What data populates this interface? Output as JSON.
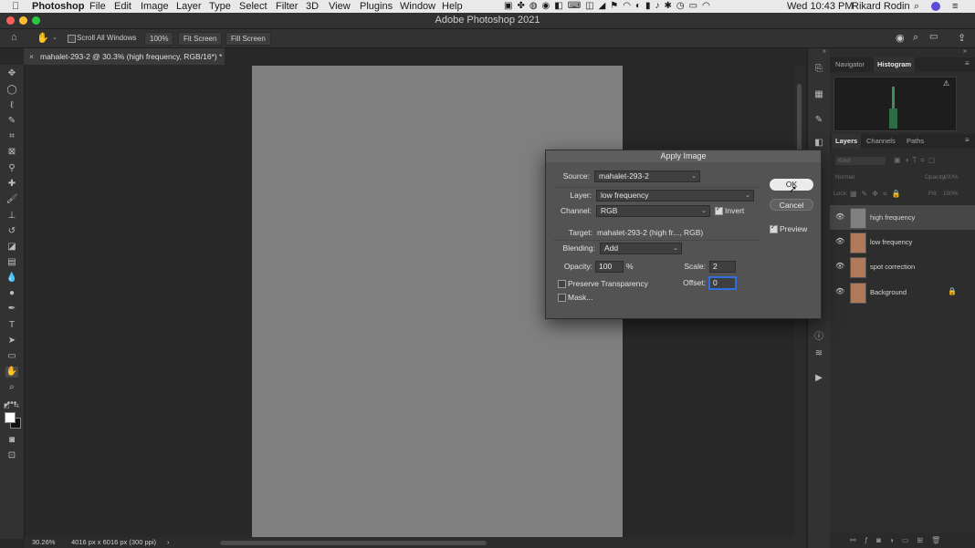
{
  "menubar": {
    "apple_icon": "apple-icon",
    "app": "Photoshop",
    "items": [
      "File",
      "Edit",
      "Image",
      "Layer",
      "Type",
      "Select",
      "Filter",
      "3D",
      "View",
      "Plugins",
      "Window",
      "Help"
    ],
    "clock": "Wed 10:43 PM",
    "user": "Rikard Rodin"
  },
  "window": {
    "title": "Adobe Photoshop 2021"
  },
  "options": {
    "scroll_all_label": "Scroll All Windows",
    "zoom_btn": "100%",
    "fit_screen_btn": "Fit Screen",
    "fill_screen_btn": "Fill Screen"
  },
  "document": {
    "tab_title": "mahalet-293-2 @ 30.3% (high frequency, RGB/16*) *",
    "close": "×"
  },
  "status": {
    "zoom": "30.26%",
    "dimensions": "4016 px x 6016 px (300 ppi)",
    "arrow": "›"
  },
  "panels": {
    "top_tabs": [
      "Navigator",
      "Histogram"
    ],
    "top_active": "Histogram",
    "layer_tabs": [
      "Layers",
      "Channels",
      "Paths"
    ],
    "layer_active": "Layers",
    "kind": "Kind",
    "blend": "Normal",
    "opacity": "Opacity:",
    "opacity_val": "100%",
    "lock": "Lock:",
    "fill": "Fill:",
    "fill_val": "100%",
    "layers": [
      {
        "name": "high frequency",
        "selected": true,
        "thumb": "gray"
      },
      {
        "name": "low frequency",
        "selected": false,
        "thumb": "photo"
      },
      {
        "name": "spot correction",
        "selected": false,
        "thumb": "photo"
      },
      {
        "name": "Background",
        "selected": false,
        "thumb": "photo",
        "locked": true
      }
    ]
  },
  "dialog": {
    "title": "Apply Image",
    "source_label": "Source:",
    "source_value": "mahalet-293-2",
    "layer_label": "Layer:",
    "layer_value": "low frequency",
    "channel_label": "Channel:",
    "channel_value": "RGB",
    "invert_label": "Invert",
    "invert_checked": true,
    "target_label": "Target:",
    "target_value": "mahalet-293-2 (high fr..., RGB)",
    "blending_label": "Blending:",
    "blending_value": "Add",
    "opacity_label": "Opacity:",
    "opacity_value": "100",
    "percent": "%",
    "scale_label": "Scale:",
    "scale_value": "2",
    "offset_label": "Offset:",
    "offset_value": "0",
    "preserve_label": "Preserve Transparency",
    "mask_label": "Mask...",
    "ok_label": "OK",
    "cancel_label": "Cancel",
    "preview_label": "Preview",
    "preview_checked": true
  },
  "colors": {
    "canvas": "#808080",
    "dialog_bg": "#535353",
    "accent": "#2f6fe0"
  }
}
